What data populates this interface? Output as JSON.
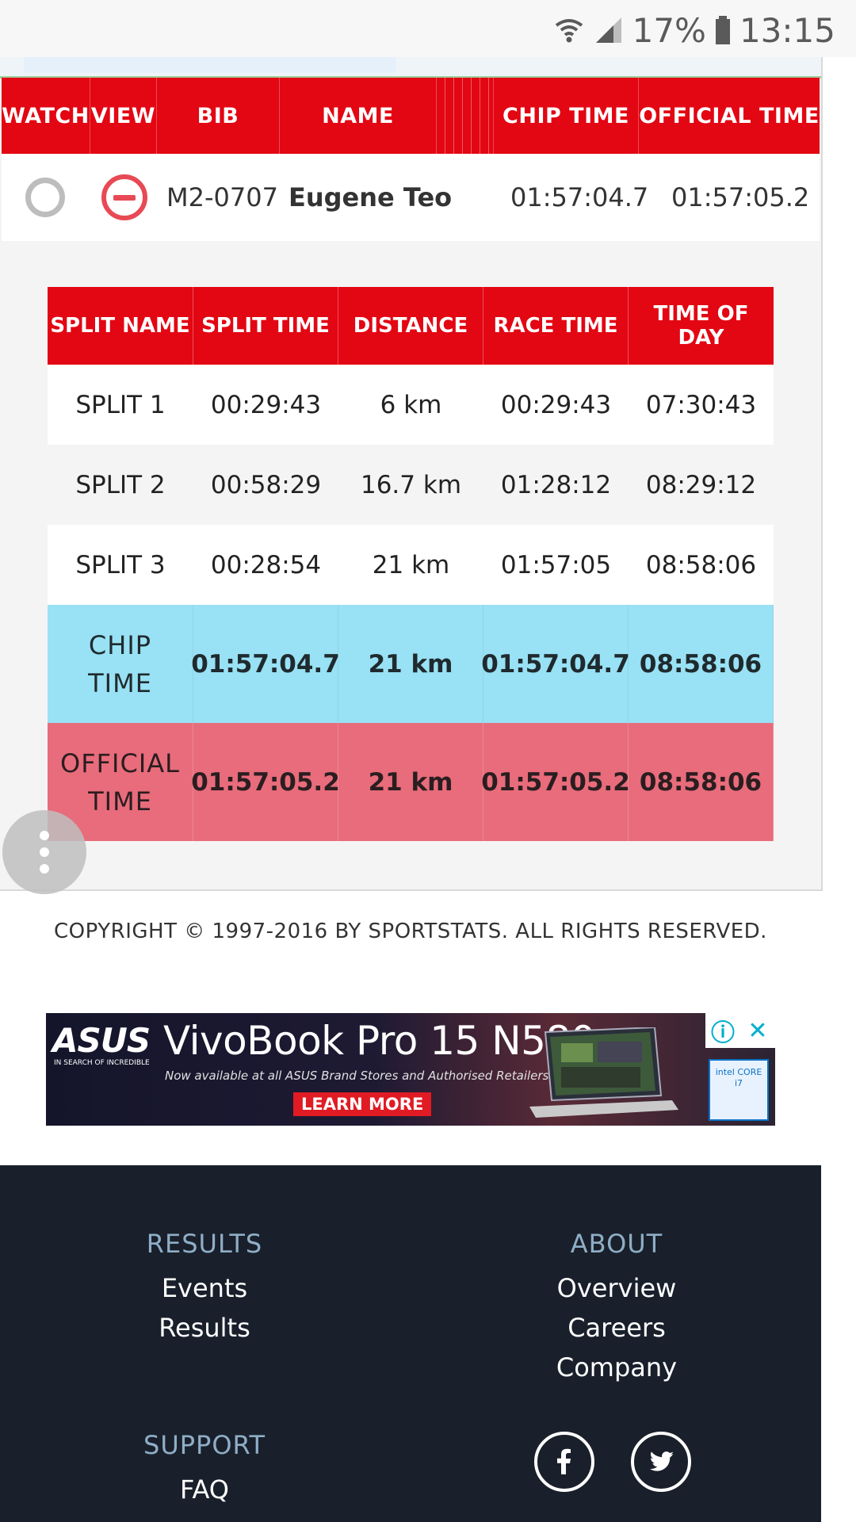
{
  "status_bar": {
    "battery": "17%",
    "time": "13:15"
  },
  "results_table": {
    "headers": [
      "WATCH",
      "VIEW",
      "BIB",
      "NAME",
      "CHIP TIME",
      "OFFICIAL TIME"
    ],
    "row": {
      "bib": "M2-0707",
      "name": "Eugene Teo",
      "chip_time": "01:57:04.7",
      "official_time": "01:57:05.2"
    }
  },
  "splits_table": {
    "headers": [
      "SPLIT NAME",
      "SPLIT TIME",
      "DISTANCE",
      "RACE TIME",
      "TIME OF DAY"
    ],
    "rows": [
      [
        "SPLIT 1",
        "00:29:43",
        "6 km",
        "00:29:43",
        "07:30:43"
      ],
      [
        "SPLIT 2",
        "00:58:29",
        "16.7 km",
        "01:28:12",
        "08:29:12"
      ],
      [
        "SPLIT 3",
        "00:28:54",
        "21 km",
        "01:57:05",
        "08:58:06"
      ]
    ],
    "chip_row": {
      "label_line1": "CHIP",
      "label_line2": "TIME",
      "values": [
        "01:57:04.7",
        "21 km",
        "01:57:04.7",
        "08:58:06"
      ]
    },
    "official_row": {
      "label_line1": "OFFICIAL",
      "label_line2": "TIME",
      "values": [
        "01:57:05.2",
        "21 km",
        "01:57:05.2",
        "08:58:06"
      ]
    }
  },
  "copyright": "COPYRIGHT © 1997-2016 BY SPORTSTATS. ALL RIGHTS RESERVED.",
  "ad": {
    "brand": "ASUS",
    "tagline": "IN SEARCH OF INCREDIBLE",
    "headline": "VivoBook Pro 15 N580",
    "subline": "Now available at all ASUS Brand Stores and Authorised Retailers",
    "cta": "LEARN MORE",
    "badge": "intel CORE i7"
  },
  "footer": {
    "results": {
      "heading": "RESULTS",
      "links": [
        "Events",
        "Results"
      ]
    },
    "about": {
      "heading": "ABOUT",
      "links": [
        "Overview",
        "Careers",
        "Company"
      ]
    },
    "support": {
      "heading": "SUPPORT",
      "links": [
        "FAQ"
      ]
    },
    "social": [
      "facebook-icon",
      "twitter-icon"
    ]
  },
  "colors": {
    "brand_red": "#e30613",
    "chip_row": "#99e1f4",
    "official_row": "#e86c7b",
    "footer_bg": "#19202b"
  }
}
